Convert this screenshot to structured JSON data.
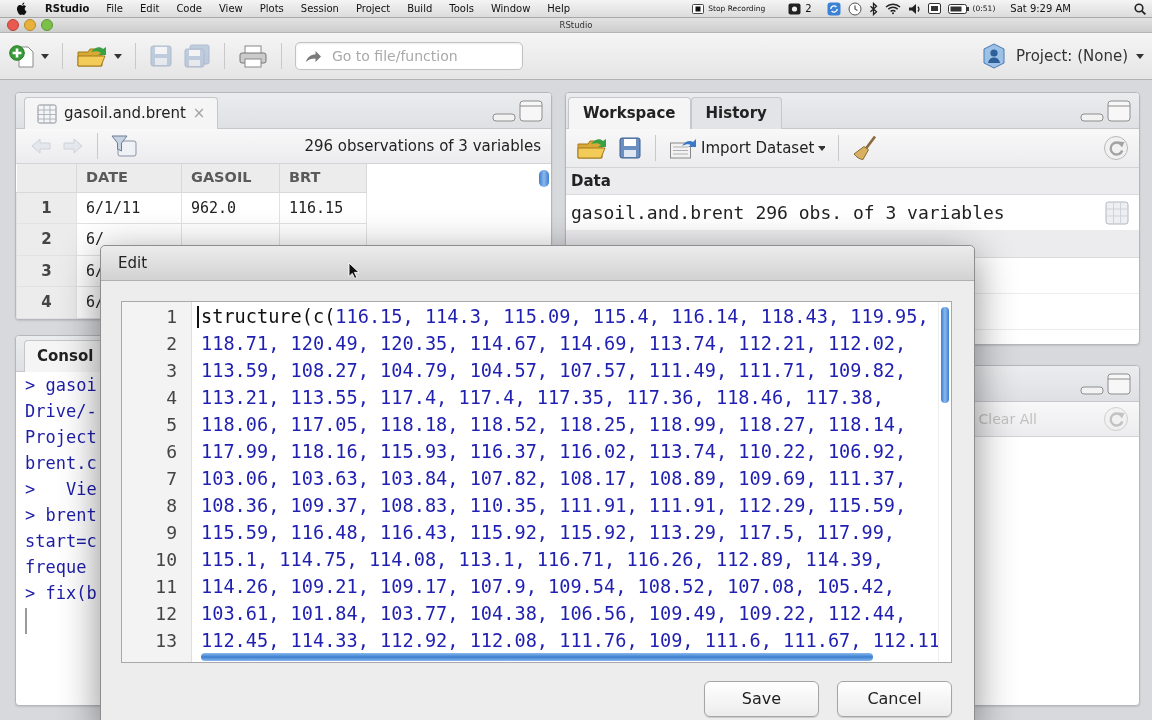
{
  "menu_bar": {
    "app_name": "RStudio",
    "menus": [
      "File",
      "Edit",
      "Code",
      "View",
      "Plots",
      "Session",
      "Project",
      "Build",
      "Tools",
      "Window",
      "Help"
    ],
    "recording": "Stop Recording",
    "badge": "2",
    "battery": "(0:51)",
    "clock": "Sat 9:29 AM"
  },
  "window": {
    "title": "RStudio"
  },
  "toolbar": {
    "buttons": [
      {
        "kind": "new",
        "disabled": false
      },
      {
        "kind": "open",
        "disabled": false
      },
      {
        "kind": "save",
        "disabled": true
      },
      {
        "kind": "save_all",
        "disabled": true
      },
      {
        "kind": "print",
        "disabled": false
      }
    ],
    "search": {
      "placeholder": "Go to file/function"
    },
    "project": "Project: (None)"
  },
  "data_viewer": {
    "tab": {
      "label": "gasoil.and.brent",
      "close": "×"
    },
    "nav": {
      "disabled": true
    },
    "summary": "296 observations of 3 variables",
    "columns": [
      "DATE",
      "GASOIL",
      "BRT"
    ],
    "rows": [
      {
        "index": "1",
        "cells": [
          "6/1/11",
          "962.0",
          "116.15"
        ]
      },
      {
        "index": "2",
        "cells": [
          "6/"
        ]
      },
      {
        "index": "3",
        "cells": [
          "6/"
        ]
      },
      {
        "index": "4",
        "cells": [
          "6/"
        ]
      }
    ]
  },
  "console": {
    "tab": "Consol",
    "lines": [
      "> gasoi",
      "Drive/-",
      "Project",
      "brent.c",
      ">   Vie",
      "> brent",
      "start=c",
      "freque",
      "> fix(b"
    ]
  },
  "workspace": {
    "tabs": [
      {
        "label": "Workspace",
        "selected": true
      },
      {
        "label": "History",
        "selected": false
      }
    ],
    "import_button": "Import Dataset",
    "sections": [
      {
        "title": "Data",
        "items": [
          {
            "name": "gasoil.and.brent",
            "value": "296 obs. of 3 variables"
          }
        ]
      }
    ]
  },
  "history": {
    "clear_button": {
      "label": "Clear All",
      "disabled": true
    }
  },
  "edit_dialog": {
    "title": "Edit",
    "lines": [
      {
        "number": "1",
        "code": "structure(c(116.15, 114.3, 115.09, 115.4, 116.14, 118.43, 119.95,"
      },
      {
        "number": "2",
        "code": "118.71, 120.49, 120.35, 114.67, 114.69, 113.74, 112.21, 112.02,"
      },
      {
        "number": "3",
        "code": "113.59, 108.27, 104.79, 104.57, 107.57, 111.49, 111.71, 109.82,"
      },
      {
        "number": "4",
        "code": "113.21, 113.55, 117.4, 117.4, 117.35, 117.36, 118.46, 117.38,"
      },
      {
        "number": "5",
        "code": "118.06, 117.05, 118.18, 118.52, 118.25, 118.99, 118.27, 118.14,"
      },
      {
        "number": "6",
        "code": "117.99, 118.16, 115.93, 116.37, 116.02, 113.74, 110.22, 106.92,"
      },
      {
        "number": "7",
        "code": "103.06, 103.63, 103.84, 107.82, 108.17, 108.89, 109.69, 111.37,"
      },
      {
        "number": "8",
        "code": "108.36, 109.37, 108.83, 110.35, 111.91, 111.91, 112.29, 115.59,"
      },
      {
        "number": "9",
        "code": "115.59, 116.48, 116.43, 115.92, 115.92, 113.29, 117.5, 117.99,"
      },
      {
        "number": "10",
        "code": "115.1, 114.75, 114.08, 113.1, 116.71, 116.26, 112.89, 114.39,"
      },
      {
        "number": "11",
        "code": "114.26, 109.21, 109.17, 107.9, 109.54, 108.52, 107.08, 105.42,"
      },
      {
        "number": "12",
        "code": "103.61, 101.84, 103.77, 104.38, 106.56, 109.49, 109.22, 112.44,"
      },
      {
        "number": "13",
        "code": "112.45, 114.33, 112.92, 112.08, 111.76, 109, 111.6, 111.67, 112.11"
      }
    ],
    "buttons": [
      {
        "label": "Save"
      },
      {
        "label": "Cancel"
      }
    ]
  }
}
